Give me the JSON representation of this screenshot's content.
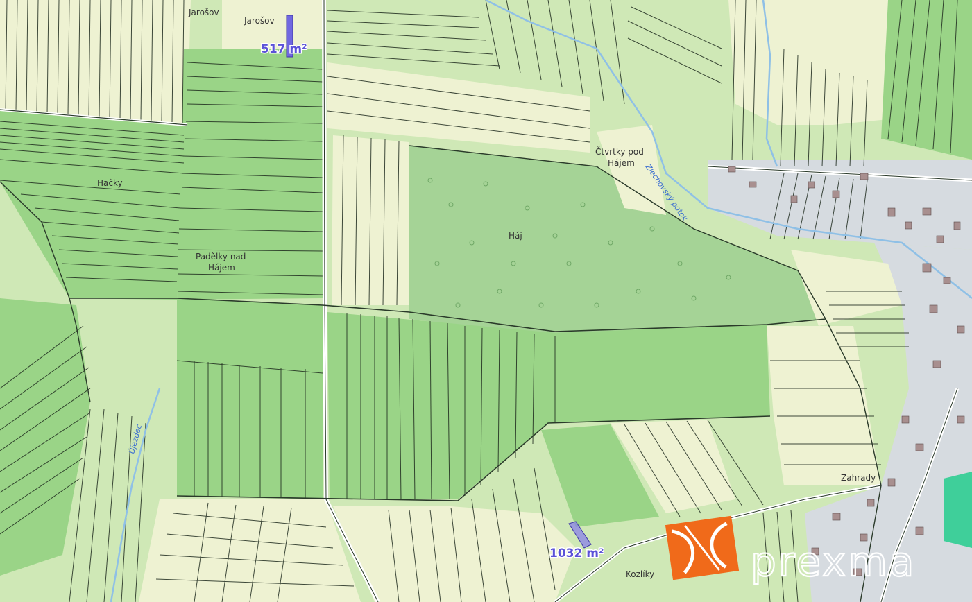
{
  "map": {
    "place_labels": [
      {
        "id": "jarosov-1",
        "text": "Jarošov"
      },
      {
        "id": "jarosov-2",
        "text": "Jarošov"
      },
      {
        "id": "hacky",
        "text": "Hačky"
      },
      {
        "id": "padelky-1",
        "text": "Padělky nad"
      },
      {
        "id": "padelky-2",
        "text": "Hájem"
      },
      {
        "id": "haj",
        "text": "Háj"
      },
      {
        "id": "ctvrtky-1",
        "text": "Čtvrtky pod"
      },
      {
        "id": "ctvrtky-2",
        "text": "Hájem"
      },
      {
        "id": "kozliky",
        "text": "Kozlíky"
      },
      {
        "id": "zahrady",
        "text": "Zahrady"
      }
    ],
    "streams": [
      {
        "id": "stream-east",
        "text": "Zlechovský potok"
      },
      {
        "id": "stream-west",
        "text": "Újezdec"
      }
    ],
    "parcel_areas": [
      {
        "id": "parcel-north",
        "text": "517 m²",
        "highlight_color": "#7068e0"
      },
      {
        "id": "parcel-south",
        "text": "1032 m²",
        "highlight_color": "#7068e0"
      }
    ],
    "colors": {
      "arable": "#eef2d2",
      "grass": "#cfe8b6",
      "meadow": "#9ad487",
      "forest": "#a5d396",
      "built": "#d6dbe0",
      "water": "#8fc0e6",
      "parcel_line": "#1e2a1e",
      "highlight": "#7068e0",
      "logo": "#f06a1a"
    }
  },
  "watermark": {
    "brand_text": "prexma",
    "logo_icon": "prexma-logo-icon"
  }
}
